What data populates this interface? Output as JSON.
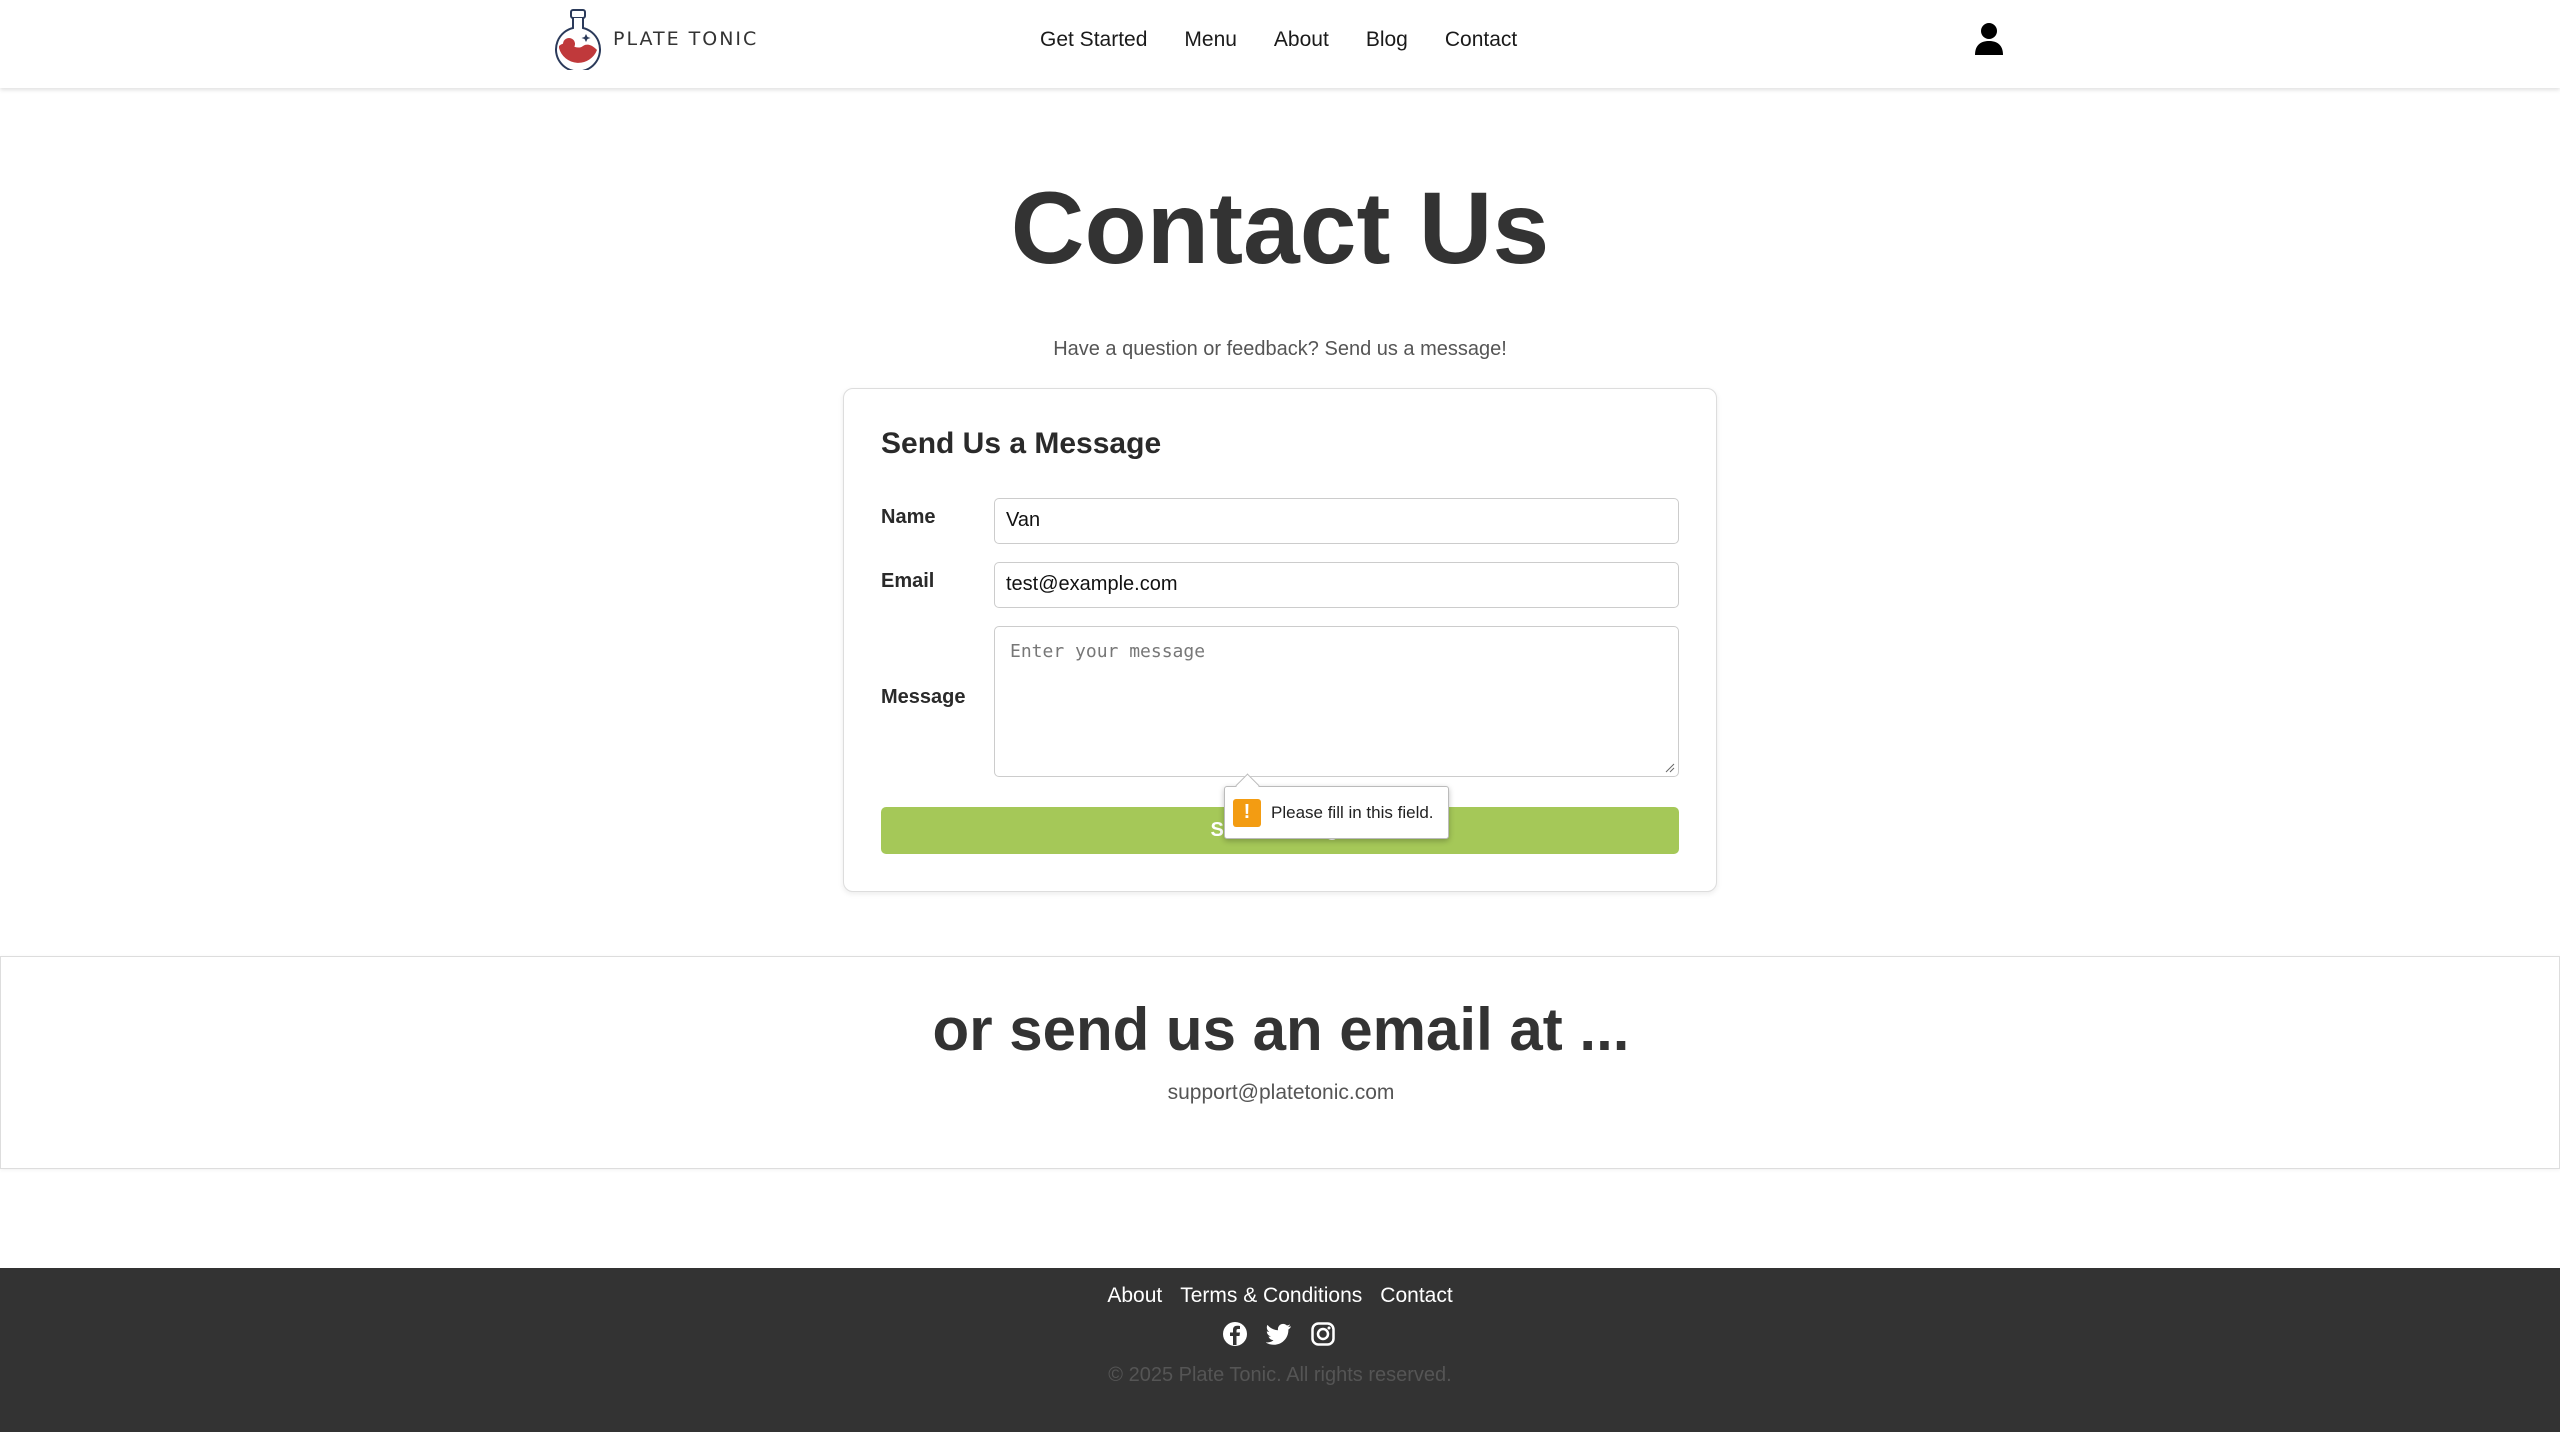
{
  "header": {
    "logo_text": "PLATE TONIC",
    "nav": [
      "Get Started",
      "Menu",
      "About",
      "Blog",
      "Contact"
    ]
  },
  "hero": {
    "title": "Contact Us",
    "subtitle": "Have a question or feedback? Send us a message!"
  },
  "form": {
    "title": "Send Us a Message",
    "name_label": "Name",
    "name_value": "Van",
    "email_label": "Email",
    "email_value": "test@example.com",
    "message_label": "Message",
    "message_placeholder": "Enter your message",
    "submit_label": "Send Message",
    "validation_message": "Please fill in this field."
  },
  "email_section": {
    "heading": "or send us an email at ...",
    "address": "support@platetonic.com"
  },
  "footer": {
    "links": [
      "About",
      "Terms & Conditions",
      "Contact"
    ],
    "social_icons": [
      "facebook-icon",
      "twitter-icon",
      "instagram-icon"
    ],
    "copyright": "© 2025 Plate Tonic. All rights reserved."
  },
  "colors": {
    "accent_green": "#a5c858",
    "footer_bg": "#333333",
    "warning": "#f39c12",
    "logo_red": "#c0393b"
  }
}
